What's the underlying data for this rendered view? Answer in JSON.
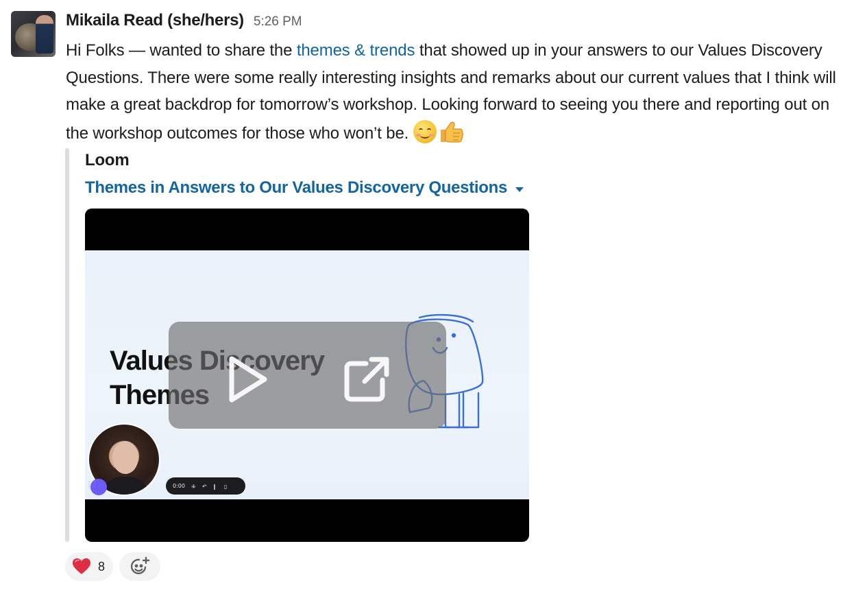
{
  "message": {
    "author": "Mikaila Read (she/hers)",
    "time": "5:26 PM",
    "text_before_link": "Hi Folks — wanted to share the ",
    "link_text": "themes & trends",
    "text_after_link": " that showed up in your answers to our Values Discovery Questions. There were some really interesting insights and remarks about our current values that I think will make a great backdrop for tomorrow’s workshop. Looking forward to seeing you there and reporting out on the workshop outcomes for those who won’t be. ",
    "emojis": [
      "relieved-smile-emoji",
      "thumbs-up-emoji"
    ],
    "link_color": "#1264a3"
  },
  "unfurl": {
    "service": "Loom",
    "title": "Themes in Answers to Our Values Discovery Questions",
    "video": {
      "slide_title": "Values Discovery\nThemes",
      "recorder_time": "0:00"
    }
  },
  "reactions": [
    {
      "emoji": "heart-emoji",
      "count": "8"
    }
  ]
}
